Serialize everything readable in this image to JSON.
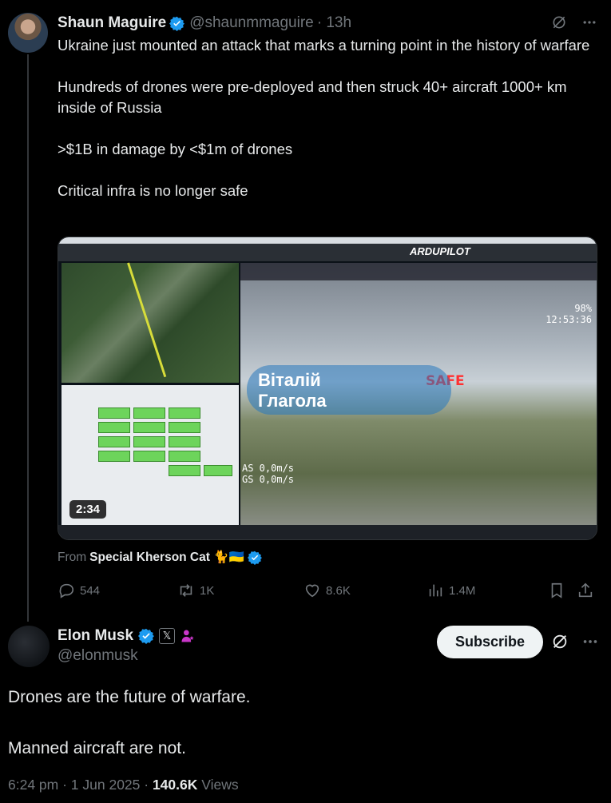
{
  "tweet": {
    "author_name": "Shaun Maguire",
    "handle": "@shaunmmaguire",
    "time": "· 13h",
    "text": "Ukraine just mounted an attack that marks a turning point in the history of warfare\n\nHundreds of drones were pre-deployed and then struck 40+ aircraft 1000+ km inside of Russia\n\n>$1B in damage by <$1m of drones\n\nCritical infra is no longer safe",
    "media": {
      "duration": "2:34",
      "hud_safe": "SAFE",
      "hud_speed": "AS 0,0m/s\nGS 0,0m/s",
      "hud_readout": "98%\n12:53:36",
      "watermark": "Віталій\nГлагола",
      "brand": "ARDUPILOT"
    },
    "from_label": "From",
    "from_source": "Special Kherson Cat 🐈🇺🇦",
    "actions": {
      "replies": "544",
      "reposts": "1K",
      "likes": "8.6K",
      "views": "1.4M"
    }
  },
  "reply": {
    "author_name": "Elon Musk",
    "handle": "@elonmusk",
    "subscribe_label": "Subscribe",
    "text": "Drones are the future of warfare.\n\nManned aircraft are not.",
    "timestamp": "6:24 pm · 1 Jun 2025 · ",
    "views_count": "140.6K",
    "views_label": " Views"
  },
  "colors": {
    "background": "#000000",
    "text": "#e7e9ea",
    "muted": "#71767b",
    "verified": "#1d9bf0",
    "subscribe_bg": "#eff3f4"
  },
  "icons": [
    "verified-icon",
    "grok-icon",
    "more-icon",
    "reply-icon",
    "repost-icon",
    "like-icon",
    "views-icon",
    "bookmark-icon",
    "share-icon",
    "x-badge-icon",
    "affiliate-icon"
  ]
}
